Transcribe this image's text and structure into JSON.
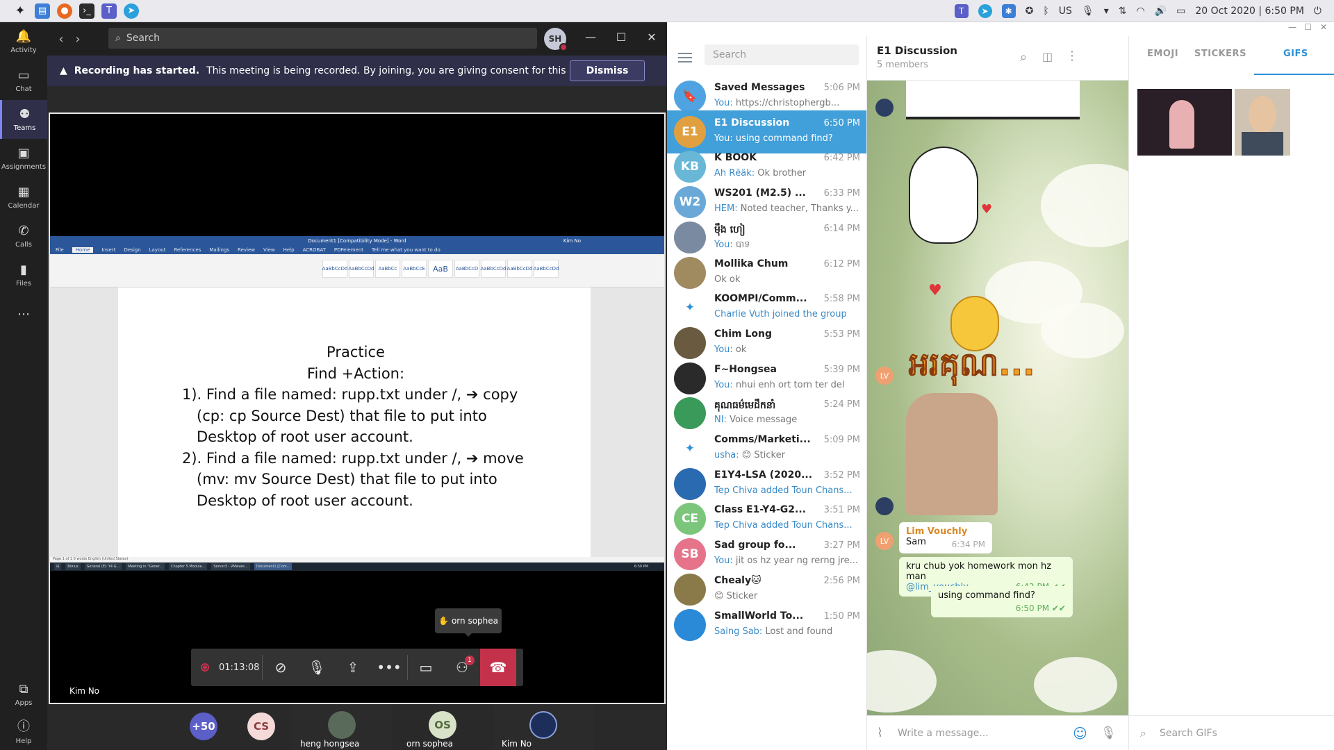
{
  "system": {
    "lang": "US",
    "datetime": "20 Oct 2020 | 6:50 PM"
  },
  "teams": {
    "rail": [
      {
        "label": "Activity",
        "icon": "bell-icon"
      },
      {
        "label": "Chat",
        "icon": "chat-icon"
      },
      {
        "label": "Teams",
        "icon": "teams-icon"
      },
      {
        "label": "Assignments",
        "icon": "assignments-icon"
      },
      {
        "label": "Calendar",
        "icon": "calendar-icon"
      },
      {
        "label": "Calls",
        "icon": "phone-icon"
      },
      {
        "label": "Files",
        "icon": "files-icon"
      },
      {
        "label": "Apps",
        "icon": "apps-icon"
      },
      {
        "label": "Help",
        "icon": "help-icon"
      }
    ],
    "search_placeholder": "Search",
    "user_initials": "SH",
    "banner_bold": "Recording has started.",
    "banner_text": "This meeting is being recorded. By joining, you are giving consent for this meeting ...",
    "dismiss_label": "Dismiss",
    "call_timer": "01:13:08",
    "tooltip_name": "orn sophea",
    "participants_badge": "1",
    "presenter_name": "Kim No",
    "participants": {
      "overflow": "+50",
      "cs_initials": "CS",
      "heng_name": "heng hongsea",
      "os_initials": "OS",
      "orn_name": "orn sophea",
      "kim_name": "Kim No"
    }
  },
  "word": {
    "title": "Document1 [Compatibility Mode] - Word",
    "user": "Kim No",
    "tabs": [
      "File",
      "Home",
      "Insert",
      "Design",
      "Layout",
      "References",
      "Mailings",
      "Review",
      "View",
      "Help",
      "ACROBAT",
      "PDFelement",
      "Tell me what you want to do"
    ],
    "styles": [
      "AaBbCcDd",
      "AaBbCcDd",
      "AaBbCc",
      "AaBbCcE",
      "AaB",
      "AaBbCcD",
      "AaBbCcDd",
      "AaBbCcDd",
      "AaBbCcDd"
    ],
    "doc": {
      "line1": "Practice",
      "line2": "Find +Action:",
      "line3": "1). Find a file named: rupp.txt under /, ➔ copy",
      "line4": "(cp: cp Source Dest) that file to put into",
      "line5": "Desktop of root user account.",
      "line6": "2). Find a file named: rupp.txt under /, ➔ move",
      "line7": "(mv: mv Source Dest) that file to put into",
      "line8": "Desktop of root user account."
    },
    "status": "Page 1 of 1    0 words    English (United States)",
    "taskbar": [
      "Bonus",
      "General (E1 Y4 G...",
      "Meeting in \"Gener...",
      "Chapter 5 Module...",
      "Server3 - VMware...",
      "Document1 [Com..."
    ],
    "taskbar_time": "6:50 PM"
  },
  "telegram": {
    "search_placeholder": "Search",
    "chats": [
      {
        "name": "Saved Messages",
        "time": "5:06 PM",
        "who": "You:",
        "msg": " https://christophergb...",
        "color": "#4fa3e0",
        "initials": "🔖"
      },
      {
        "name": "E1 Discussion",
        "time": "6:50 PM",
        "who": "You:",
        "msg": " using command find?",
        "color": "#e0a040",
        "initials": "E1"
      },
      {
        "name": "K BOOK",
        "time": "6:42 PM",
        "who": "Ãh Rēäk:",
        "msg": " Ok brother",
        "color": "#68b7d6",
        "initials": "KB"
      },
      {
        "name": "WS201 (M2.5) ...",
        "time": "6:33 PM",
        "who": "HEM:",
        "msg": " Noted teacher, Thanks y...",
        "color": "#6aa8d8",
        "initials": "W2"
      },
      {
        "name": "ម៉ឹង ហៀ",
        "time": "6:14 PM",
        "who": "You:",
        "msg": " បាទ",
        "color": "#7a8aa0",
        "initials": ""
      },
      {
        "name": "Mollika Chum",
        "time": "6:12 PM",
        "who": "",
        "msg": "Ok ok",
        "color": "#a08a60",
        "initials": ""
      },
      {
        "name": "KOOMPI/Comm...",
        "time": "5:58 PM",
        "who": "",
        "msg": "Charlie Vuth joined the group",
        "color": "#ffffff",
        "initials": "✦"
      },
      {
        "name": "Chim Long",
        "time": "5:53 PM",
        "who": "You:",
        "msg": " ok",
        "color": "#6a5a40",
        "initials": ""
      },
      {
        "name": "F~Hongsea",
        "time": "5:39 PM",
        "who": "You:",
        "msg": " nhui enh ort torn ter del",
        "color": "#2a2a2a",
        "initials": ""
      },
      {
        "name": "គុណធម៌មេដឹកនាំ",
        "time": "5:24 PM",
        "who": "NI:",
        "msg": " Voice message",
        "color": "#3a9a5a",
        "initials": ""
      },
      {
        "name": "Comms/Marketi...",
        "time": "5:09 PM",
        "who": "usha:",
        "msg": " 😊 Sticker",
        "color": "#ffffff",
        "initials": "✦"
      },
      {
        "name": "E1Y4-LSA (2020...",
        "time": "3:52 PM",
        "who": "",
        "msg": "Tep Chiva added Toun Chans...",
        "color": "#2a6ab0",
        "initials": ""
      },
      {
        "name": "Class E1-Y4-G2...",
        "time": "3:51 PM",
        "who": "",
        "msg": "Tep Chiva added Toun Chans...",
        "color": "#7bc67b",
        "initials": "CE"
      },
      {
        "name": "Sad group fo...",
        "time": "3:27 PM",
        "who": "You:",
        "msg": " jit os hz year ng rerng jre...",
        "color": "#e5738a",
        "initials": "SB"
      },
      {
        "name": "Chealy🐱",
        "time": "2:56 PM",
        "who": "",
        "msg": "😊 Sticker",
        "color": "#8a7a4a",
        "initials": ""
      },
      {
        "name": "SmallWorld To...",
        "time": "1:50 PM",
        "who": "Saing Sab:",
        "msg": " Lost and found",
        "color": "#2a8ad8",
        "initials": ""
      }
    ],
    "chat_title": "E1 Discussion",
    "chat_subtitle": "5 members",
    "sticker_text": "អរគុណ...",
    "msg_sender": "Lim Vouchly",
    "msg_sender_initials": "LV",
    "msg_text1": "Sam",
    "msg_time1": "6:34 PM",
    "msg_text2": "kru chub yok homework mon hz man",
    "msg_mention": "@lim_vouchly",
    "msg_time2": "6:42 PM",
    "msg_text3": "using command find?",
    "msg_time3": "6:50 PM",
    "input_placeholder": "Write a message...",
    "panel_tabs": [
      "EMOJI",
      "STICKERS",
      "GIFS"
    ],
    "gif_search_placeholder": "Search GIFs",
    "accent": "#419fd9"
  }
}
